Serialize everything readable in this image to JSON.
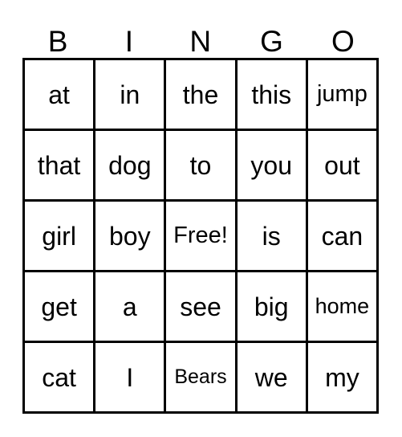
{
  "card": {
    "title": "BINGO",
    "columns": [
      "B",
      "I",
      "N",
      "G",
      "O"
    ],
    "rows": [
      {
        "cells": [
          {
            "text": "at",
            "size": "normal"
          },
          {
            "text": "in",
            "size": "normal"
          },
          {
            "text": "the",
            "size": "normal"
          },
          {
            "text": "this",
            "size": "normal"
          },
          {
            "text": "jump",
            "size": "small"
          }
        ]
      },
      {
        "cells": [
          {
            "text": "that",
            "size": "normal"
          },
          {
            "text": "dog",
            "size": "normal"
          },
          {
            "text": "to",
            "size": "normal"
          },
          {
            "text": "you",
            "size": "normal"
          },
          {
            "text": "out",
            "size": "normal"
          }
        ]
      },
      {
        "cells": [
          {
            "text": "girl",
            "size": "normal"
          },
          {
            "text": "boy",
            "size": "normal"
          },
          {
            "text": "Free!",
            "size": "small"
          },
          {
            "text": "is",
            "size": "normal"
          },
          {
            "text": "can",
            "size": "normal"
          }
        ]
      },
      {
        "cells": [
          {
            "text": "get",
            "size": "normal"
          },
          {
            "text": "a",
            "size": "normal"
          },
          {
            "text": "see",
            "size": "normal"
          },
          {
            "text": "big",
            "size": "normal"
          },
          {
            "text": "home",
            "size": "x-small"
          }
        ]
      },
      {
        "cells": [
          {
            "text": "cat",
            "size": "normal"
          },
          {
            "text": "I",
            "size": "normal"
          },
          {
            "text": "Bears",
            "size": "xx-small"
          },
          {
            "text": "we",
            "size": "normal"
          },
          {
            "text": "my",
            "size": "normal"
          }
        ]
      }
    ],
    "free_space": {
      "row": 2,
      "column": 2,
      "label": "Free!"
    },
    "colors": {
      "background": "#ffffff",
      "border": "#000000",
      "text": "#000000"
    }
  }
}
